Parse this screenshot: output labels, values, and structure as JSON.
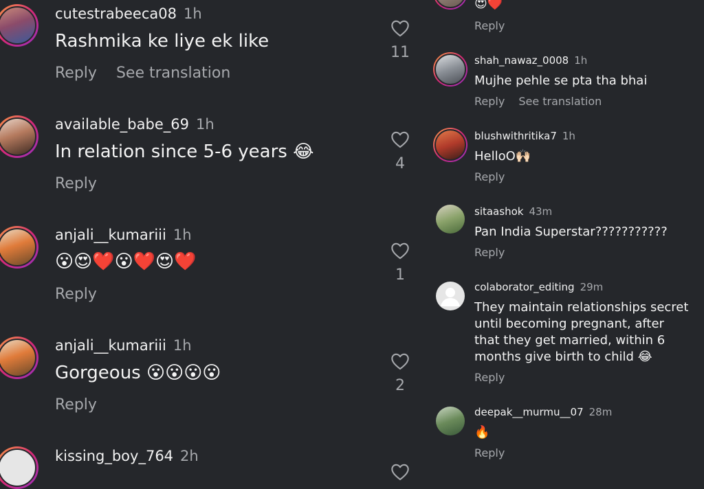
{
  "left_comments": [
    {
      "username": "cutestrabeeca08",
      "time": "1h",
      "text": "Rashmika ke liye ek like",
      "reply_label": "Reply",
      "translate_label": "See translation",
      "like_count": "11"
    },
    {
      "username": "available_babe_69",
      "time": "1h",
      "text": "In relation since 5-6 years 😂",
      "reply_label": "Reply",
      "like_count": "4"
    },
    {
      "username": "anjali__kumariii",
      "time": "1h",
      "text": "😮😍❤️😮❤️😍❤️",
      "reply_label": "Reply",
      "like_count": "1"
    },
    {
      "username": "anjali__kumariii",
      "time": "1h",
      "text": "Gorgeous 😮😮😮😮",
      "reply_label": "Reply",
      "like_count": "2"
    },
    {
      "username": "kissing_boy_764",
      "time": "2h"
    }
  ],
  "right_comments": [
    {
      "text": "😍❤️",
      "reply_label": "Reply"
    },
    {
      "username": "shah_nawaz_0008",
      "time": "1h",
      "text": "Mujhe pehle se pta tha bhai",
      "reply_label": "Reply",
      "translate_label": "See translation"
    },
    {
      "username": "blushwithritika7",
      "time": "1h",
      "text": "HelloO🙌🏻",
      "reply_label": "Reply"
    },
    {
      "username": "sitaashok",
      "time": "43m",
      "text": "Pan India Superstar???????????",
      "reply_label": "Reply"
    },
    {
      "username": "colaborator_editing",
      "time": "29m",
      "text": "They maintain relationships secret until becoming pregnant, after that they get married, within 6 months give birth to child 😂",
      "reply_label": "Reply"
    },
    {
      "username": "deepak__murmu__07",
      "time": "28m",
      "text": "🔥",
      "reply_label": "Reply"
    }
  ],
  "colors": {
    "background": "#25272b",
    "text_primary": "#f2f2f2",
    "text_secondary": "#a7a9ad",
    "story_ring_start": "#f9a03f",
    "story_ring_end": "#962fbf"
  },
  "icons": {
    "like": "heart-outline-icon",
    "default_avatar": "default-user-avatar-icon"
  }
}
